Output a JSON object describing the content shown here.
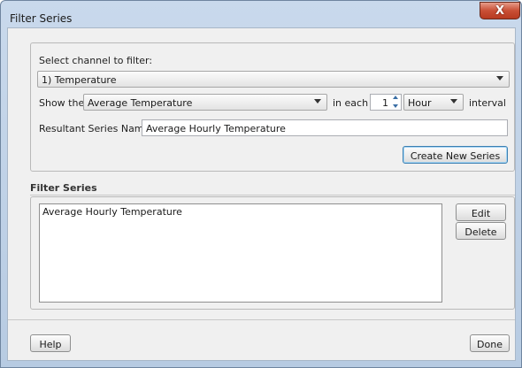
{
  "window": {
    "title": "Filter Series",
    "close_label": "X"
  },
  "channel": {
    "label": "Select channel to filter:",
    "selected": "1) Temperature"
  },
  "show": {
    "label_prefix": "Show the",
    "selected": "Average Temperature",
    "in_each_label": "in each",
    "interval_count": "1",
    "unit_selected": "Hour",
    "interval_label": "interval"
  },
  "result": {
    "label": "Resultant Series Name:",
    "value": "Average Hourly Temperature"
  },
  "create_button": "Create New Series",
  "filter_series": {
    "title": "Filter Series",
    "items": [
      "Average Hourly Temperature"
    ],
    "edit_button": "Edit",
    "delete_button": "Delete"
  },
  "footer": {
    "help_button": "Help",
    "done_button": "Done"
  }
}
